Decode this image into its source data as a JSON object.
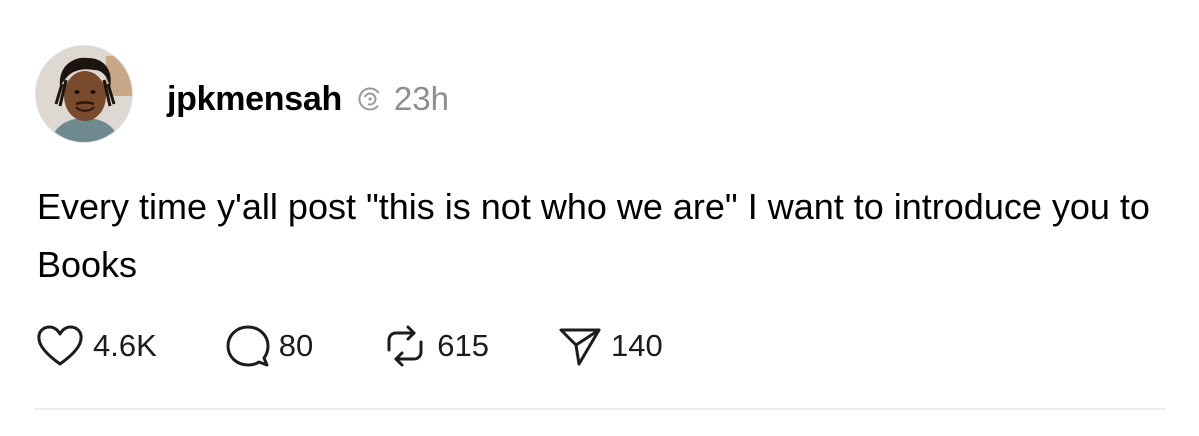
{
  "post": {
    "author": {
      "username": "jpkmensah",
      "avatar": "person-avatar",
      "badge_icon": "threads-icon"
    },
    "time": "23h",
    "text": "Every time y'all post \"this is not who we are\" I want to introduce you to Books",
    "actions": {
      "like": {
        "icon": "heart-icon",
        "count": "4.6K"
      },
      "reply": {
        "icon": "comment-icon",
        "count": "80"
      },
      "repost": {
        "icon": "repost-icon",
        "count": "615"
      },
      "share": {
        "icon": "send-icon",
        "count": "140"
      }
    }
  },
  "colors": {
    "text": "#000000",
    "muted": "#8e8e8e",
    "divider": "#ececec"
  }
}
